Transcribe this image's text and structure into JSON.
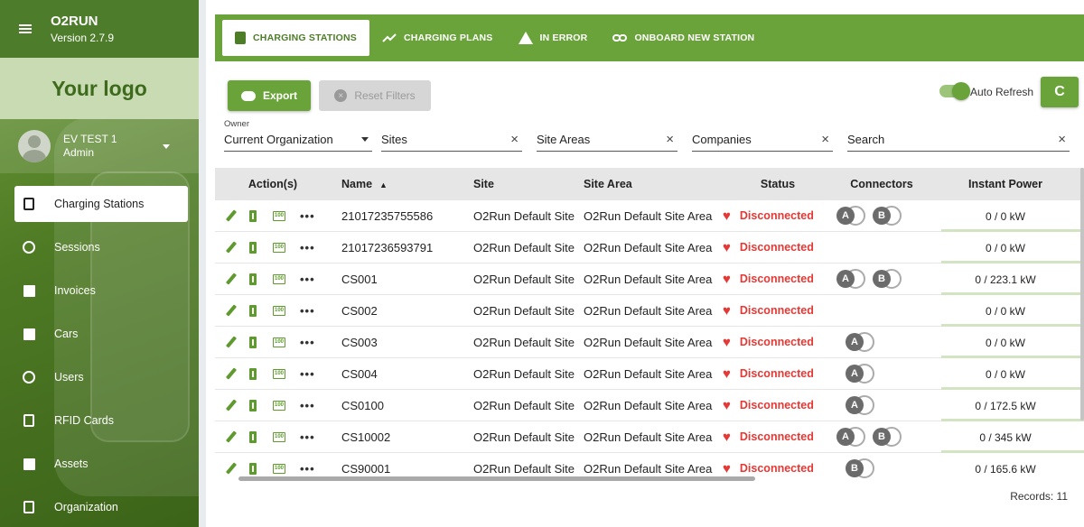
{
  "app": {
    "name": "O2RUN",
    "version": "Version 2.7.9",
    "logo_text": "Your logo"
  },
  "user": {
    "name": "EV TEST 1",
    "role": "Admin"
  },
  "sidebar": {
    "items": [
      {
        "label": "Charging Stations",
        "icon": "charging-station-icon",
        "active": true
      },
      {
        "label": "Sessions",
        "icon": "history-icon"
      },
      {
        "label": "Invoices",
        "icon": "invoice-icon"
      },
      {
        "label": "Cars",
        "icon": "car-icon"
      },
      {
        "label": "Users",
        "icon": "users-icon"
      },
      {
        "label": "RFID Cards",
        "icon": "badge-icon"
      },
      {
        "label": "Assets",
        "icon": "bank-icon"
      },
      {
        "label": "Organization",
        "icon": "building-icon"
      }
    ]
  },
  "tabs": [
    {
      "label": "CHARGING STATIONS",
      "icon": "charging-station-icon",
      "active": true
    },
    {
      "label": "CHARGING PLANS",
      "icon": "trend-icon"
    },
    {
      "label": "IN ERROR",
      "icon": "warning-icon"
    },
    {
      "label": "ONBOARD NEW STATION",
      "icon": "link-icon"
    }
  ],
  "toolbar": {
    "export_label": "Export",
    "reset_label": "Reset Filters",
    "auto_refresh_label": "Auto Refresh",
    "auto_refresh_on": true,
    "refresh_symbol": "C"
  },
  "filters": {
    "owner_caption": "Owner",
    "owner_value": "Current Organization",
    "sites": "Sites",
    "site_areas": "Site Areas",
    "companies": "Companies",
    "search": "Search",
    "clear_symbol": "×"
  },
  "table": {
    "headers": {
      "actions": "Action(s)",
      "name": "Name",
      "sort": "▲",
      "site": "Site",
      "area": "Site Area",
      "status": "Status",
      "connectors": "Connectors",
      "power": "Instant Power"
    },
    "rows": [
      {
        "name": "21017235755586",
        "site": "O2Run Default Site",
        "area": "O2Run Default Site Area",
        "status": "Disconnected",
        "connectors": [
          "A",
          "B"
        ],
        "power": "0 / 0 kW"
      },
      {
        "name": "21017236593791",
        "site": "O2Run Default Site",
        "area": "O2Run Default Site Area",
        "status": "Disconnected",
        "connectors": [],
        "power": "0 / 0 kW"
      },
      {
        "name": "CS001",
        "site": "O2Run Default Site",
        "area": "O2Run Default Site Area",
        "status": "Disconnected",
        "connectors": [
          "A",
          "B"
        ],
        "power": "0 / 223.1 kW"
      },
      {
        "name": "CS002",
        "site": "O2Run Default Site",
        "area": "O2Run Default Site Area",
        "status": "Disconnected",
        "connectors": [],
        "power": "0 / 0 kW"
      },
      {
        "name": "CS003",
        "site": "O2Run Default Site",
        "area": "O2Run Default Site Area",
        "status": "Disconnected",
        "connectors": [
          "A"
        ],
        "power": "0 / 0 kW"
      },
      {
        "name": "CS004",
        "site": "O2Run Default Site",
        "area": "O2Run Default Site Area",
        "status": "Disconnected",
        "connectors": [
          "A"
        ],
        "power": "0 / 0 kW"
      },
      {
        "name": "CS0100",
        "site": "O2Run Default Site",
        "area": "O2Run Default Site Area",
        "status": "Disconnected",
        "connectors": [
          "A"
        ],
        "power": "0 / 172.5 kW"
      },
      {
        "name": "CS10002",
        "site": "O2Run Default Site",
        "area": "O2Run Default Site Area",
        "status": "Disconnected",
        "connectors": [
          "A",
          "B"
        ],
        "power": "0 / 345 kW"
      },
      {
        "name": "CS90001",
        "site": "O2Run Default Site",
        "area": "O2Run Default Site Area",
        "status": "Disconnected",
        "connectors": [
          "B"
        ],
        "power": "0 / 165.6 kW"
      }
    ]
  },
  "footer": {
    "records": "Records: 11"
  },
  "colors": {
    "brand": "#6aa33a",
    "status_error": "#e53935",
    "connector_badge": "#6b6b6b"
  }
}
